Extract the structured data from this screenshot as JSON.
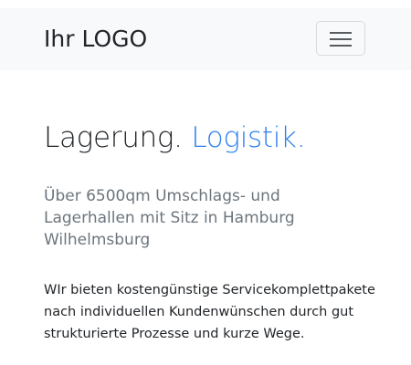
{
  "navbar": {
    "brand": "Ihr LOGO",
    "toggler_icon": "hamburger-menu-icon"
  },
  "hero": {
    "title_main": "Lagerung.",
    "title_accent": "Logistik.",
    "accent_color": "#2f80ed",
    "subtitle": "Über 6500qm Umschlags- und Lagerhallen mit Sitz in Hamburg Wilhelmsburg",
    "body": "WIr bieten kostengünstige Servicekomplettpakete nach individuellen Kundenwünschen durch gut strukturierte Prozesse und kurze Wege."
  }
}
